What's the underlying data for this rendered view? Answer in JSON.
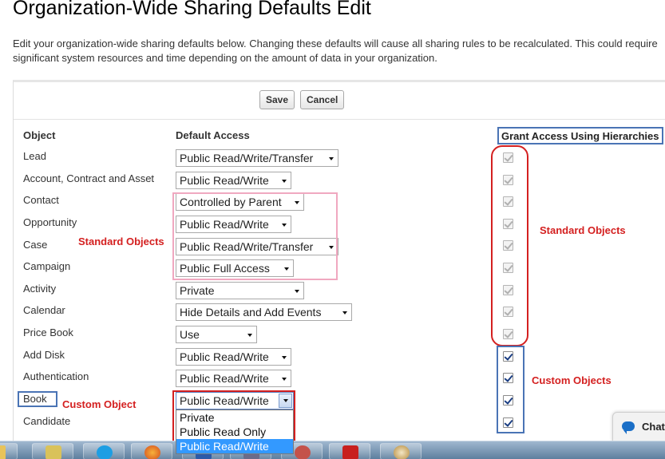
{
  "page": {
    "title": "Organization-Wide Sharing Defaults Edit",
    "description": "Edit your organization-wide sharing defaults below. Changing these defaults will cause all sharing rules to be recalculated. This could require significant system resources and time depending on the amount of data in your organization."
  },
  "buttons": {
    "save": "Save",
    "cancel": "Cancel"
  },
  "columns": {
    "object": "Object",
    "default_access": "Default Access",
    "grant_access": "Grant Access Using Hierarchies"
  },
  "rows": [
    {
      "object": "Lead",
      "access": "Public Read/Write/Transfer",
      "hierarchy": "checked-disabled"
    },
    {
      "object": "Account, Contract and Asset",
      "access": "Public Read/Write",
      "hierarchy": "checked-disabled"
    },
    {
      "object": "Contact",
      "access": "Controlled by Parent",
      "hierarchy": "checked-disabled"
    },
    {
      "object": "Opportunity",
      "access": "Public Read/Write",
      "hierarchy": "checked-disabled"
    },
    {
      "object": "Case",
      "access": "Public Read/Write/Transfer",
      "hierarchy": "checked-disabled"
    },
    {
      "object": "Campaign",
      "access": "Public Full Access",
      "hierarchy": "checked-disabled"
    },
    {
      "object": "Activity",
      "access": "Private",
      "hierarchy": "checked-disabled"
    },
    {
      "object": "Calendar",
      "access": "Hide Details and Add Events",
      "hierarchy": "checked-disabled"
    },
    {
      "object": "Price Book",
      "access": "Use",
      "hierarchy": "checked-disabled"
    },
    {
      "object": "Add Disk",
      "access": "Public Read/Write",
      "hierarchy": "checked"
    },
    {
      "object": "Authentication",
      "access": "Public Read/Write",
      "hierarchy": "checked"
    },
    {
      "object": "Book",
      "access": "Public Read/Write",
      "hierarchy": "checked"
    },
    {
      "object": "Candidate",
      "access": "",
      "hierarchy": "checked"
    }
  ],
  "dropdown": {
    "options": [
      "Private",
      "Public Read Only",
      "Public Read/Write"
    ],
    "highlighted": "Public Read/Write"
  },
  "annotations": {
    "standard_objects_left": "Standard Objects",
    "standard_objects_right": "Standard Objects",
    "custom_objects": "Custom Objects",
    "custom_object": "Custom Object"
  },
  "chat": {
    "label": "Chat"
  },
  "taskbar": {
    "apps": [
      "folder-icon",
      "skype-icon",
      "firefox-icon",
      "word-icon",
      "media-icon",
      "acrobat-icon",
      "paint-icon"
    ]
  },
  "colors": {
    "annotation_red": "#d42020",
    "annotation_blue": "#4a74b5",
    "annotation_pink": "#f0a8c0",
    "dropdown_highlight": "#3399ff"
  }
}
